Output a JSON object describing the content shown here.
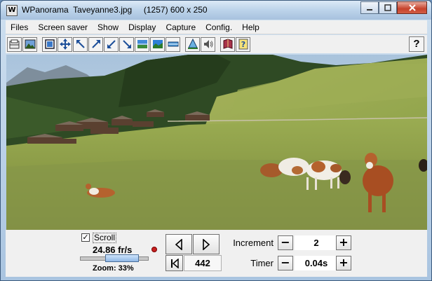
{
  "window": {
    "title": "WPanorama  Taveyanne3.jpg     (1257) 600 x 250",
    "app_icon_letter": "W"
  },
  "menu": [
    "Files",
    "Screen saver",
    "Show",
    "Display",
    "Capture",
    "Config.",
    "Help"
  ],
  "toolbar": {
    "buttons": [
      "open-icon",
      "picture-icon",
      "window-icon",
      "move-icon",
      "shrink-tl-icon",
      "expand-tr-icon",
      "shrink-br-icon",
      "expand-br-icon",
      "horizon-icon",
      "horizon-2-icon",
      "flat-icon",
      "pyramid-icon",
      "sound-icon",
      "book-icon",
      "help-doc-icon"
    ],
    "help_label": "?"
  },
  "controls": {
    "scroll_checked": "✓",
    "scroll_label": "Scroll",
    "fps": "24.86 fr/s",
    "zoom_label": "Zoom: 33%",
    "zoom_percent": 33,
    "frame_number": "442",
    "increment_label": "Increment",
    "increment_value": "2",
    "timer_label": "Timer",
    "timer_value": "0.04s",
    "minus": "−",
    "plus": "+"
  },
  "colors": {
    "sky": "#b9cfe3",
    "forest": "#2f4a24",
    "meadow": "#8ea048",
    "close_button": "#c6422b"
  }
}
